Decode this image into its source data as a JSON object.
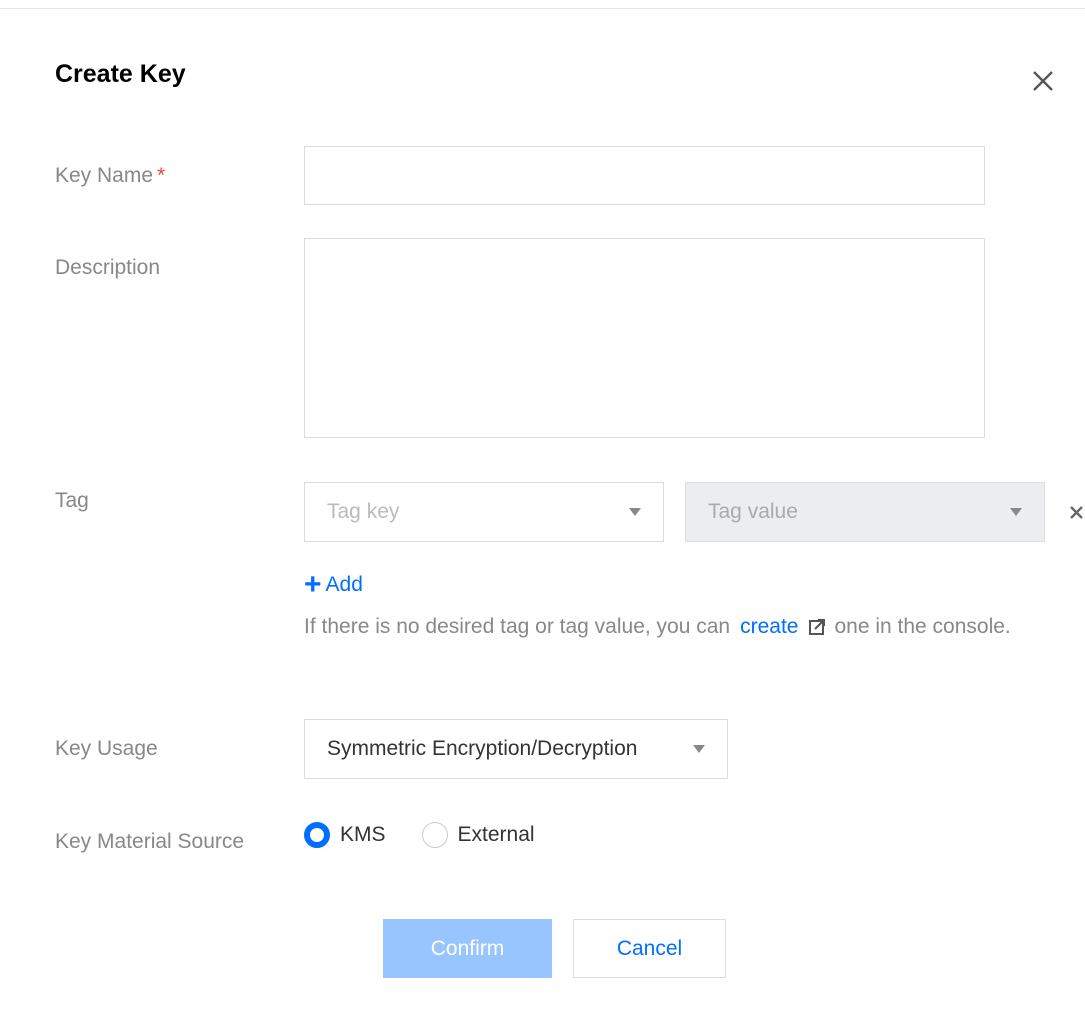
{
  "dialog": {
    "title": "Create Key"
  },
  "form": {
    "key_name": {
      "label": "Key Name",
      "required_mark": "*",
      "value": "",
      "placeholder": ""
    },
    "description": {
      "label": "Description",
      "value": "",
      "placeholder": ""
    },
    "tag": {
      "label": "Tag",
      "key_placeholder": "Tag key",
      "value_placeholder": "Tag value",
      "add_label": "Add",
      "hint_before": "If there is no desired tag or tag value, you can",
      "hint_link": "create",
      "hint_after": "one in the console."
    },
    "key_usage": {
      "label": "Key Usage",
      "selected": "Symmetric Encryption/Decryption"
    },
    "key_material_source": {
      "label": "Key Material Source",
      "options": [
        {
          "label": "KMS",
          "checked": true
        },
        {
          "label": "External",
          "checked": false
        }
      ]
    }
  },
  "buttons": {
    "confirm": "Confirm",
    "cancel": "Cancel"
  },
  "icons": {
    "close": "close-icon",
    "tag_remove": "close-icon",
    "external_link": "external-link-icon",
    "dropdown": "caret-down-icon",
    "add": "plus-icon"
  },
  "colors": {
    "primary": "#006eff",
    "primary_disabled": "#99c5ff",
    "required": "#e54545",
    "label": "#888888",
    "border": "#dcdcdc",
    "disabled_bg": "#ebedf0"
  }
}
